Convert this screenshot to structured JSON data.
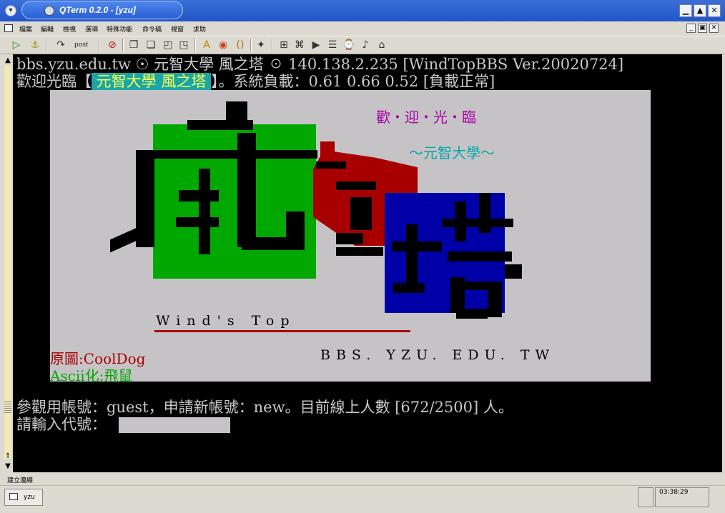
{
  "window": {
    "title": "QTerm 0.2.0 - [yzu]"
  },
  "menu": [
    "檔案",
    "編輯",
    "檢視",
    "選項",
    "特殊功能",
    "命令稿",
    "視窗",
    "求助"
  ],
  "toolbar": {
    "post_label": "post"
  },
  "terminal": {
    "line1": "bbs.yzu.edu.tw ☉ 元智大學 風之塔 ☉ 140.138.2.235 [WindTopBBS Ver.20020724]",
    "line2_prefix": "歡迎光臨【",
    "line2_highlight": " 元智大學 風之塔 ",
    "line2_suffix": "】。系統負載：0.61 0.66 0.52 [負載正常]",
    "banner": {
      "welcome": "歡・迎・光・臨",
      "school": "～元智大學～",
      "wind_top": "Wind's Top",
      "bbs_host": "BBS. YZU. EDU. TW",
      "credit_label": "原圖:",
      "credit_name": "CoolDog",
      "ascii_label": "Ascii化:",
      "ascii_name": "飛鼠"
    },
    "guest_line": "參觀用帳號：guest，申請新帳號：new。目前線上人數 [672/2500] 人。",
    "login_prompt": "請輸入代號："
  },
  "status": {
    "connection": "建立連線"
  },
  "taskbar": {
    "tab_label": "yzu",
    "clock": "03:38:29"
  },
  "colors": {
    "green": "#00a800",
    "red": "#a80000",
    "blue": "#0000a8",
    "purple": "#a800a8",
    "cyan": "#00a8a8",
    "grey": "#c6c3c6"
  }
}
